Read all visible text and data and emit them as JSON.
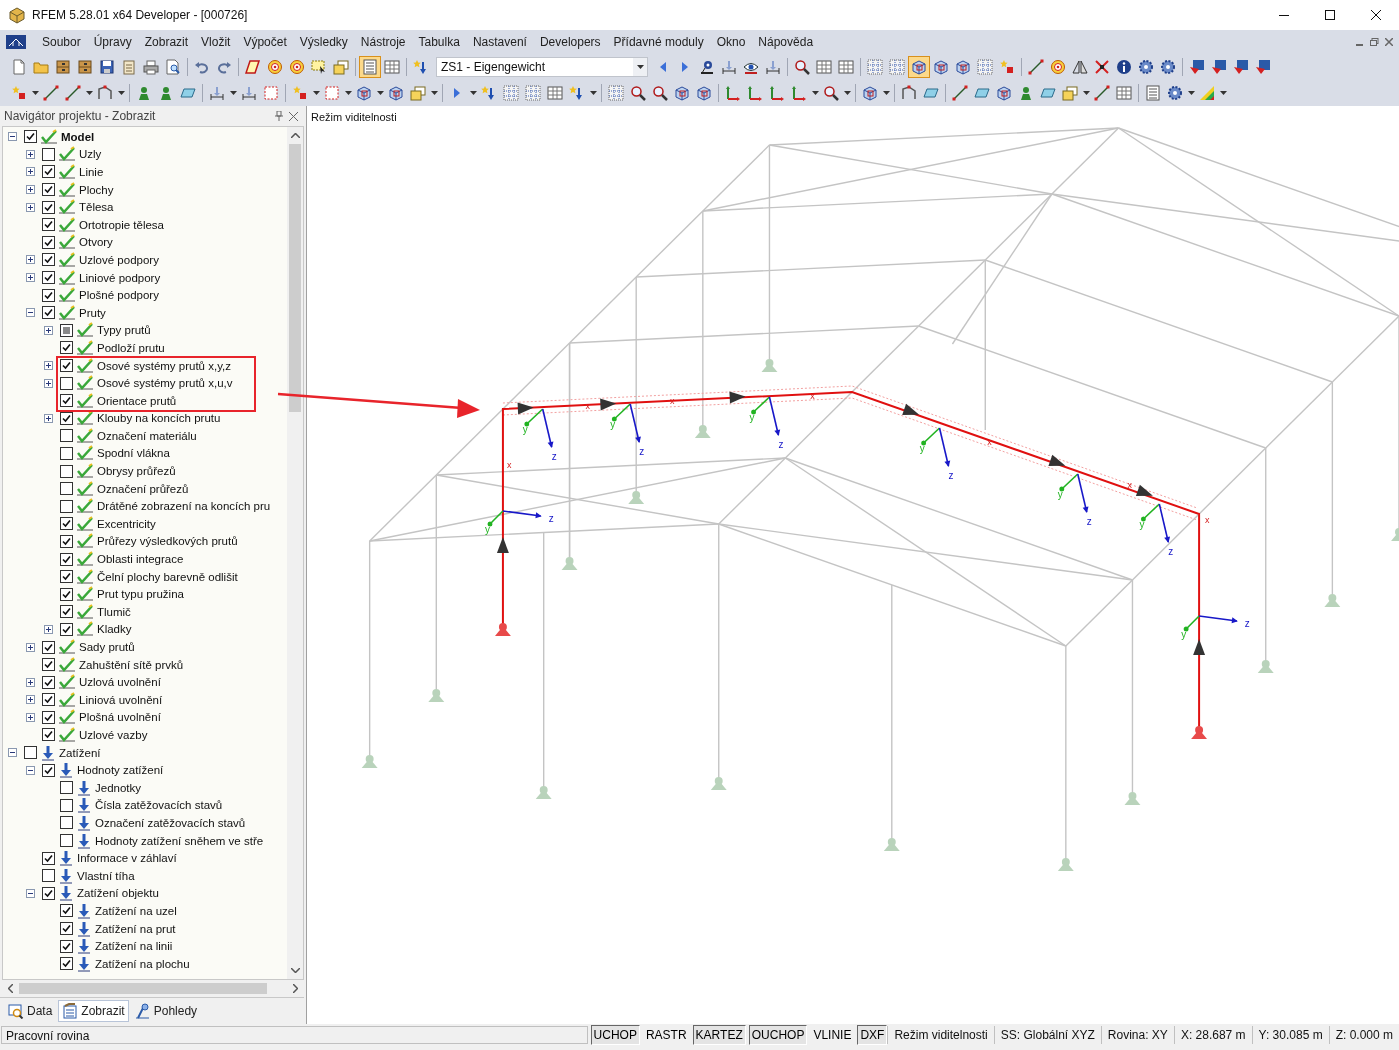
{
  "window": {
    "title": "RFEM 5.28.01 x64 Developer - [000726]"
  },
  "menu": [
    {
      "label": "Soubor"
    },
    {
      "label": "Úpravy"
    },
    {
      "label": "Zobrazit"
    },
    {
      "label": "Vložit"
    },
    {
      "label": "Výpočet"
    },
    {
      "label": "Výsledky"
    },
    {
      "label": "Nástroje"
    },
    {
      "label": "Tabulka"
    },
    {
      "label": "Nastavení"
    },
    {
      "label": "Developers"
    },
    {
      "label": "Přídavné moduly"
    },
    {
      "label": "Okno"
    },
    {
      "label": "Nápověda"
    }
  ],
  "toolbars": [
    {
      "items": [
        {
          "kind": "document",
          "on": false
        },
        {
          "kind": "folder",
          "on": false
        },
        {
          "kind": "cabinet",
          "on": false
        },
        {
          "kind": "cabinet",
          "on": false
        },
        {
          "kind": "save",
          "on": false
        },
        {
          "kind": "clipboard",
          "on": false
        },
        {
          "kind": "printer",
          "on": false
        },
        {
          "kind": "preview",
          "on": false
        },
        {
          "kind": "separator"
        },
        {
          "kind": "undo",
          "on": false
        },
        {
          "kind": "redo",
          "on": false
        },
        {
          "kind": "separator"
        },
        {
          "kind": "polygon",
          "on": false
        },
        {
          "kind": "target",
          "on": false
        },
        {
          "kind": "target",
          "on": false
        },
        {
          "kind": "select",
          "on": false
        },
        {
          "kind": "windows",
          "on": false
        },
        {
          "kind": "separator"
        },
        {
          "kind": "list",
          "on": true
        },
        {
          "kind": "table",
          "on": false
        },
        {
          "kind": "separator"
        },
        {
          "kind": "loadcase",
          "on": false
        },
        {
          "kind": "combo",
          "value": "ZS1 - Eigengewicht",
          "on": false
        },
        {
          "kind": "arrow-left",
          "on": false
        },
        {
          "kind": "arrow-right",
          "on": false
        },
        {
          "kind": "pin",
          "on": false
        },
        {
          "kind": "dimension",
          "on": false
        },
        {
          "kind": "eye",
          "on": false
        },
        {
          "kind": "dimension",
          "on": false
        },
        {
          "kind": "separator"
        },
        {
          "kind": "magnifier",
          "on": false
        },
        {
          "kind": "table",
          "on": false
        },
        {
          "kind": "table",
          "on": false
        },
        {
          "kind": "separator"
        },
        {
          "kind": "grid",
          "on": false
        },
        {
          "kind": "grid",
          "on": false
        },
        {
          "kind": "cube",
          "on": true
        },
        {
          "kind": "cube",
          "on": false
        },
        {
          "kind": "cube",
          "on": false
        },
        {
          "kind": "grid",
          "on": false
        },
        {
          "kind": "node",
          "on": false
        },
        {
          "kind": "separator"
        },
        {
          "kind": "line",
          "on": false
        },
        {
          "kind": "target",
          "on": false
        },
        {
          "kind": "mirror",
          "on": false
        },
        {
          "kind": "cross",
          "on": false
        },
        {
          "kind": "info",
          "on": false
        },
        {
          "kind": "gear",
          "on": false
        },
        {
          "kind": "gear",
          "on": false
        },
        {
          "kind": "separator"
        },
        {
          "kind": "export",
          "on": false
        },
        {
          "kind": "export",
          "on": false
        },
        {
          "kind": "export",
          "on": false
        },
        {
          "kind": "export",
          "on": false
        }
      ]
    },
    {
      "items": [
        {
          "kind": "node",
          "on": false
        },
        {
          "kind": "caret",
          "on": false
        },
        {
          "kind": "line",
          "on": false
        },
        {
          "kind": "line",
          "on": false
        },
        {
          "kind": "caret",
          "on": false
        },
        {
          "kind": "polyline",
          "on": false
        },
        {
          "kind": "caret",
          "on": false
        },
        {
          "kind": "separator"
        },
        {
          "kind": "support",
          "on": false
        },
        {
          "kind": "support",
          "on": false
        },
        {
          "kind": "plane",
          "on": false
        },
        {
          "kind": "separator"
        },
        {
          "kind": "dimension",
          "on": false
        },
        {
          "kind": "caret",
          "on": false
        },
        {
          "kind": "dimension",
          "on": false
        },
        {
          "kind": "frame",
          "on": false
        },
        {
          "kind": "separator"
        },
        {
          "kind": "node",
          "on": false
        },
        {
          "kind": "caret",
          "on": false
        },
        {
          "kind": "frame",
          "on": false
        },
        {
          "kind": "caret",
          "on": false
        },
        {
          "kind": "cube",
          "on": false
        },
        {
          "kind": "caret",
          "on": false
        },
        {
          "kind": "cube",
          "on": false
        },
        {
          "kind": "windows",
          "on": false
        },
        {
          "kind": "caret",
          "on": false
        },
        {
          "kind": "separator"
        },
        {
          "kind": "arrow-right",
          "on": false
        },
        {
          "kind": "caret",
          "on": false
        },
        {
          "kind": "loadcase",
          "on": false
        },
        {
          "kind": "grid",
          "on": false
        },
        {
          "kind": "grid",
          "on": false
        },
        {
          "kind": "table",
          "on": false
        },
        {
          "kind": "loadcase",
          "on": false
        },
        {
          "kind": "caret",
          "on": false
        },
        {
          "kind": "separator"
        },
        {
          "kind": "grid",
          "on": false
        },
        {
          "kind": "magnifier",
          "on": false
        },
        {
          "kind": "magnifier",
          "on": false
        },
        {
          "kind": "cube",
          "on": false
        },
        {
          "kind": "cube",
          "on": false
        },
        {
          "kind": "separator"
        },
        {
          "kind": "axis",
          "on": false
        },
        {
          "kind": "axis",
          "on": false
        },
        {
          "kind": "axis",
          "on": false
        },
        {
          "kind": "axis",
          "on": false
        },
        {
          "kind": "caret",
          "on": false
        },
        {
          "kind": "magnifier",
          "on": false
        },
        {
          "kind": "caret",
          "on": false
        },
        {
          "kind": "separator"
        },
        {
          "kind": "cube",
          "on": false
        },
        {
          "kind": "caret",
          "on": false
        },
        {
          "kind": "separator"
        },
        {
          "kind": "polyline",
          "on": false
        },
        {
          "kind": "plane",
          "on": false
        },
        {
          "kind": "separator"
        },
        {
          "kind": "line",
          "on": false
        },
        {
          "kind": "plane",
          "on": false
        },
        {
          "kind": "cube",
          "on": false
        },
        {
          "kind": "support",
          "on": false
        },
        {
          "kind": "plane",
          "on": false
        },
        {
          "kind": "windows",
          "on": false
        },
        {
          "kind": "caret",
          "on": false
        },
        {
          "kind": "line",
          "on": false
        },
        {
          "kind": "table",
          "on": false
        },
        {
          "kind": "separator"
        },
        {
          "kind": "list",
          "on": false
        },
        {
          "kind": "gear",
          "on": false
        },
        {
          "kind": "caret",
          "on": false
        },
        {
          "kind": "color-scale",
          "on": false
        },
        {
          "kind": "caret",
          "on": false
        }
      ]
    }
  ],
  "navigator": {
    "title": "Navigátor projektu - Zobrazit",
    "tree": [
      {
        "label": "Model",
        "kind": "display",
        "checked": true,
        "emphasized": true,
        "expanded": true,
        "children": [
          {
            "label": "Uzly",
            "kind": "display",
            "checked": false,
            "expanded": false
          },
          {
            "label": "Linie",
            "kind": "display",
            "checked": true,
            "expanded": false
          },
          {
            "label": "Plochy",
            "kind": "display",
            "checked": true,
            "expanded": false
          },
          {
            "label": "Tělesa",
            "kind": "display",
            "checked": true,
            "expanded": false
          },
          {
            "label": "Ortotropie tělesa",
            "kind": "display",
            "checked": true
          },
          {
            "label": "Otvory",
            "kind": "display",
            "checked": true
          },
          {
            "label": "Uzlové podpory",
            "kind": "display",
            "checked": true,
            "expanded": false
          },
          {
            "label": "Liniové podpory",
            "kind": "display",
            "checked": true,
            "expanded": false
          },
          {
            "label": "Plošné podpory",
            "kind": "display",
            "checked": true
          },
          {
            "label": "Pruty",
            "kind": "display",
            "checked": true,
            "expanded": true,
            "children": [
              {
                "label": "Typy prutů",
                "kind": "display",
                "checked": false,
                "partial": true,
                "expanded": false,
                "highlighted": false
              },
              {
                "label": "Podloží prutu",
                "kind": "display",
                "checked": true,
                "partial": false,
                "highlighted": false
              },
              {
                "label": "Osové systémy prutů x,y,z",
                "kind": "display",
                "checked": true,
                "partial": false,
                "expanded": false,
                "highlighted": true
              },
              {
                "label": "Osové systémy prutů x,u,v",
                "kind": "display",
                "checked": false,
                "partial": false,
                "expanded": false,
                "highlighted": true
              },
              {
                "label": "Orientace prutů",
                "kind": "display",
                "checked": true,
                "partial": false,
                "highlighted": true
              },
              {
                "label": "Klouby na koncích prutu",
                "kind": "display",
                "checked": true,
                "partial": false,
                "expanded": false,
                "highlighted": false
              },
              {
                "label": "Označení materiálu",
                "kind": "display",
                "checked": false,
                "partial": false,
                "highlighted": false
              },
              {
                "label": "Spodní vlákna",
                "kind": "display",
                "checked": false,
                "partial": false,
                "highlighted": false
              },
              {
                "label": "Obrysy průřezů",
                "kind": "display",
                "checked": false,
                "partial": false,
                "highlighted": false
              },
              {
                "label": "Označení průřezů",
                "kind": "display",
                "checked": false,
                "partial": false,
                "highlighted": false
              },
              {
                "label": "Drátěné zobrazení na koncích pru",
                "kind": "display",
                "checked": false,
                "partial": false,
                "highlighted": false
              },
              {
                "label": "Excentricity",
                "kind": "display",
                "checked": true,
                "partial": false,
                "highlighted": false
              },
              {
                "label": "Průřezy výsledkových prutů",
                "kind": "display",
                "checked": true,
                "partial": false,
                "highlighted": false
              },
              {
                "label": "Oblasti integrace",
                "kind": "display",
                "checked": true,
                "partial": false,
                "highlighted": false
              },
              {
                "label": "Čelní plochy barevně odlišit",
                "kind": "display",
                "checked": true,
                "partial": false,
                "highlighted": false
              },
              {
                "label": "Prut typu pružina",
                "kind": "display",
                "checked": true,
                "partial": false,
                "highlighted": false
              },
              {
                "label": "Tlumič",
                "kind": "display",
                "checked": true,
                "partial": false,
                "highlighted": false
              },
              {
                "label": "Kladky",
                "kind": "display",
                "checked": true,
                "partial": false,
                "expanded": false,
                "highlighted": false
              }
            ]
          },
          {
            "label": "Sady prutů",
            "kind": "display",
            "checked": true,
            "expanded": false
          },
          {
            "label": "Zahuštění sítě prvků",
            "kind": "display",
            "checked": true
          },
          {
            "label": "Uzlová uvolnění",
            "kind": "display",
            "checked": true,
            "expanded": false
          },
          {
            "label": "Liniová uvolnění",
            "kind": "display",
            "checked": true,
            "expanded": false
          },
          {
            "label": "Plošná uvolnění",
            "kind": "display",
            "checked": true,
            "expanded": false
          },
          {
            "label": "Uzlové vazby",
            "kind": "display",
            "checked": true
          }
        ]
      },
      {
        "label": "Zatížení",
        "kind": "load",
        "checked": false,
        "emphasized": false,
        "expanded": true,
        "children": [
          {
            "label": "Hodnoty zatížení",
            "kind": "load",
            "checked": true,
            "expanded": true,
            "children": [
              {
                "label": "Jednotky",
                "kind": "load",
                "checked": false
              },
              {
                "label": "Čísla zatěžovacích stavů",
                "kind": "load",
                "checked": false
              },
              {
                "label": "Označení zatěžovacích stavů",
                "kind": "load",
                "checked": false
              },
              {
                "label": "Hodnoty zatížení sněhem ve stře",
                "kind": "load",
                "checked": false
              }
            ]
          },
          {
            "label": "Informace v záhlaví",
            "kind": "load",
            "checked": true
          },
          {
            "label": "Vlastní tíha",
            "kind": "load",
            "checked": false
          },
          {
            "label": "Zatížení objektu",
            "kind": "load",
            "checked": true,
            "expanded": true,
            "children": [
              {
                "label": "Zatížení na uzel",
                "kind": "load",
                "checked": true
              },
              {
                "label": "Zatížení na prut",
                "kind": "load",
                "checked": true
              },
              {
                "label": "Zatížení na linii",
                "kind": "load",
                "checked": true
              },
              {
                "label": "Zatížení na plochu",
                "kind": "load",
                "checked": true
              }
            ]
          }
        ]
      }
    ],
    "tabs": [
      {
        "label": "Data",
        "kind": "data",
        "selected": false
      },
      {
        "label": "Zobrazit",
        "kind": "display",
        "selected": true
      },
      {
        "label": "Pohledy",
        "kind": "views",
        "selected": false
      }
    ]
  },
  "viewport": {
    "mode_label": "Režim viditelnosti",
    "axis_triads": [
      {
        "y": "y",
        "z": "z"
      },
      {
        "y": "y",
        "z": "z"
      },
      {
        "y": "y",
        "z": "z"
      },
      {
        "y": "y",
        "z": "z"
      },
      {
        "y": "y",
        "z": "z"
      },
      {
        "y": "y",
        "z": "z"
      },
      {
        "y": "y",
        "z": "z"
      },
      {
        "y": "y",
        "z": "z"
      }
    ],
    "x_marks": [
      "x",
      "x",
      "x",
      "x",
      "x",
      "x",
      "x"
    ]
  },
  "status_bar": {
    "hint": "Pracovní rovina",
    "toggles": [
      {
        "label": "UCHOP",
        "on": true
      },
      {
        "label": "RASTR",
        "on": false
      },
      {
        "label": "KARTEZ",
        "on": true
      },
      {
        "label": "OUCHOP",
        "on": true
      },
      {
        "label": "VLINIE",
        "on": false
      },
      {
        "label": "DXF",
        "on": true
      }
    ],
    "fields": [
      "Režim viditelnosti",
      "SS: Globální XYZ",
      "Rovina: XY",
      "X: 28.687 m",
      "Y: 30.085 m",
      "Z: 0.000 m"
    ]
  }
}
